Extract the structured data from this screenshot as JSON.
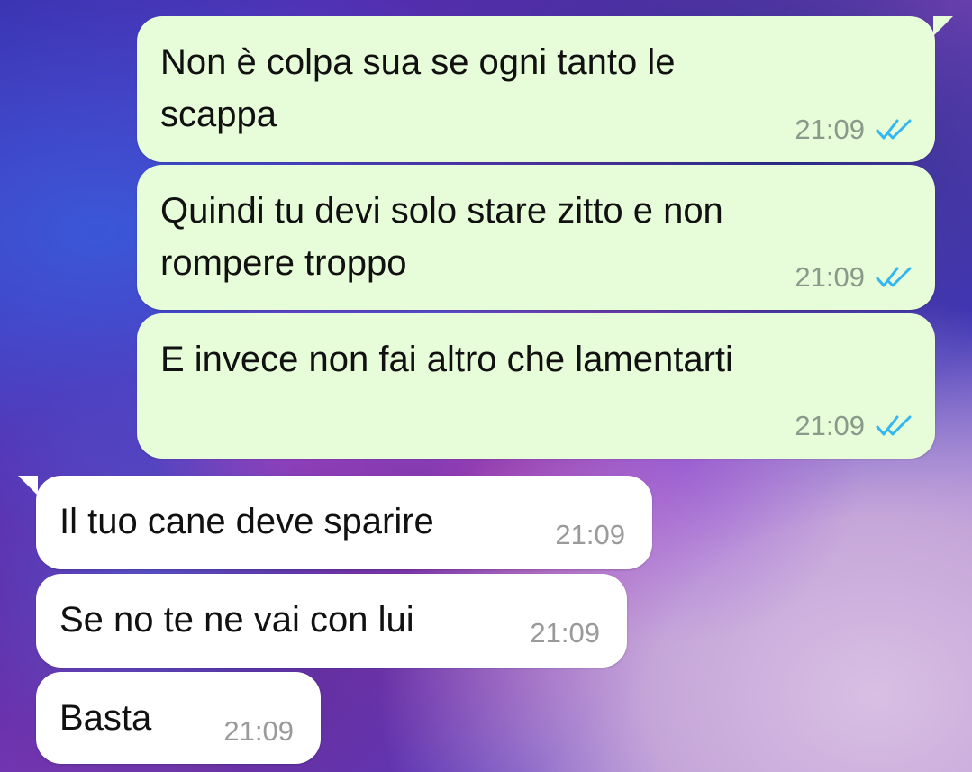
{
  "messages": [
    {
      "direction": "outgoing",
      "text": "Non è colpa sua se ogni tanto le\nscappa",
      "time": "21:09",
      "status": "read"
    },
    {
      "direction": "outgoing",
      "text": "Quindi tu devi solo stare zitto e non\nrompere troppo",
      "time": "21:09",
      "status": "read"
    },
    {
      "direction": "outgoing",
      "text": "E invece non fai altro che lamentarti",
      "time": "21:09",
      "status": "read"
    },
    {
      "direction": "incoming",
      "text": "Il tuo cane deve sparire",
      "time": "21:09"
    },
    {
      "direction": "incoming",
      "text": "Se no te ne vai con lui",
      "time": "21:09"
    },
    {
      "direction": "incoming",
      "text": "Basta",
      "time": "21:09"
    }
  ],
  "colors": {
    "outgoing_bubble": "#e7fcd8",
    "incoming_bubble": "#ffffff",
    "read_ticks": "#34b7f1"
  },
  "icons": {
    "read_receipt": "double-check-icon"
  }
}
